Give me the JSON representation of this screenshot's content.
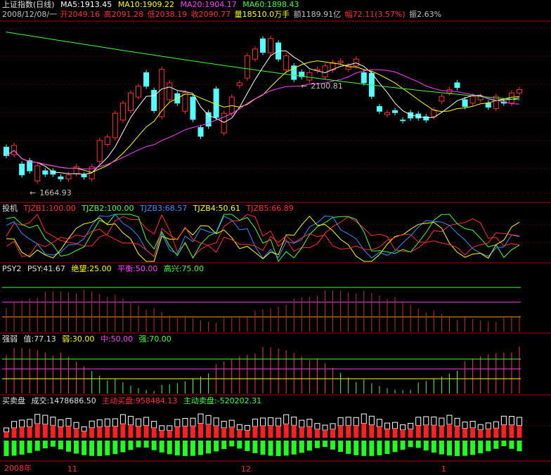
{
  "main": {
    "title": "上证指数(日线)",
    "ma": [
      {
        "label": "MA5:1913.45",
        "color": "#ffffff"
      },
      {
        "label": "MA10:1909.22",
        "color": "#ffff00"
      },
      {
        "label": "MA20:1904.17",
        "color": "#ff40ff"
      },
      {
        "label": "MA60:1898.43",
        "color": "#40ff40"
      }
    ],
    "info": [
      {
        "text": "2008/12/08/一",
        "color": "#c0c0c0"
      },
      {
        "text": "开2049.16",
        "color": "#ff3030"
      },
      {
        "text": "高2091.28",
        "color": "#ff3030"
      },
      {
        "text": "低2038.19",
        "color": "#ff3030"
      },
      {
        "text": "收2090.77",
        "color": "#ff3030"
      },
      {
        "text": "量18510.0万手",
        "color": "#ffff00"
      },
      {
        "text": "额1189.91亿",
        "color": "#c0c0c0"
      },
      {
        "text": "幅72.11(3.57%)",
        "color": "#ff3030"
      },
      {
        "text": "振2.63%",
        "color": "#c0c0c0"
      }
    ],
    "high_label": "2100.81",
    "low_label": "1664.93"
  },
  "panel_tj": {
    "title": "投机",
    "items": [
      {
        "label": "TJZB1:100.00",
        "color": "#ff3030"
      },
      {
        "label": "TJZB2:100.00",
        "color": "#40ff40"
      },
      {
        "label": "TJZB3:68.57",
        "color": "#3090ff"
      },
      {
        "label": "TJZB4:50.61",
        "color": "#ffff00"
      },
      {
        "label": "TJZB5:66.89",
        "color": "#ff3030"
      }
    ]
  },
  "panel_psy": {
    "title": "PSY2",
    "items": [
      {
        "label": "PSY:41.67",
        "color": "#e0e0e0"
      },
      {
        "label": "绝望:25.00",
        "color": "#ffff00"
      },
      {
        "label": "平衡:50.00",
        "color": "#ff40ff"
      },
      {
        "label": "高兴:75.00",
        "color": "#40ff40"
      }
    ]
  },
  "panel_qr": {
    "title": "强弱",
    "items": [
      {
        "label": "值:77.13",
        "color": "#e0e0e0"
      },
      {
        "label": "弱:30.00",
        "color": "#ffff00"
      },
      {
        "label": "中:50.00",
        "color": "#ff40ff"
      },
      {
        "label": "强:70.00",
        "color": "#40ff40"
      }
    ]
  },
  "panel_mm": {
    "title": "买卖盘",
    "items": [
      {
        "label": "成交:1478686.50",
        "color": "#e0e0e0"
      },
      {
        "label": "主动买盘:958484.13",
        "color": "#ff3030"
      },
      {
        "label": "主动卖盘:-520202.31",
        "color": "#40ff40"
      }
    ]
  },
  "time_axis": {
    "year": "2008年",
    "m11": "11",
    "m12": "12",
    "m1": "1"
  },
  "chart_data": {
    "type": "candlestick",
    "candles": [
      {
        "o": 1770,
        "c": 1745
      },
      {
        "o": 1748,
        "c": 1775
      },
      {
        "o": 1720,
        "c": 1688
      },
      {
        "o": 1730,
        "c": 1700
      },
      {
        "o": 1670,
        "c": 1715
      },
      {
        "o": 1700,
        "c": 1690
      },
      {
        "o": 1700,
        "c": 1690
      },
      {
        "o": 1682,
        "c": 1676
      },
      {
        "o": 1676,
        "c": 1688
      },
      {
        "o": 1692,
        "c": 1712
      },
      {
        "o": 1688,
        "c": 1682
      },
      {
        "o": 1676,
        "c": 1712
      },
      {
        "o": 1728,
        "c": 1790
      },
      {
        "o": 1778,
        "c": 1800
      },
      {
        "o": 1798,
        "c": 1870
      },
      {
        "o": 1850,
        "c": 1900
      },
      {
        "o": 1878,
        "c": 1930
      },
      {
        "o": 1918,
        "c": 1950
      },
      {
        "o": 1990,
        "c": 1950
      },
      {
        "o": 1938,
        "c": 1878
      },
      {
        "o": 1860,
        "c": 2000
      },
      {
        "o": 1910,
        "c": 1960
      },
      {
        "o": 1928,
        "c": 1900
      },
      {
        "o": 1876,
        "c": 1932
      },
      {
        "o": 1918,
        "c": 1852
      },
      {
        "o": 1828,
        "c": 1802
      },
      {
        "o": 1872,
        "c": 1832
      },
      {
        "o": 1942,
        "c": 1858
      },
      {
        "o": 1812,
        "c": 1870
      },
      {
        "o": 1870,
        "c": 1918
      },
      {
        "o": 1952,
        "c": 1960
      },
      {
        "o": 1974,
        "c": 2040
      },
      {
        "o": 2030,
        "c": 2060
      },
      {
        "o": 2090,
        "c": 2050
      },
      {
        "o": 2049,
        "c": 2091
      },
      {
        "o": 2078,
        "c": 2030
      },
      {
        "o": 1998,
        "c": 2040
      },
      {
        "o": 2010,
        "c": 1970
      },
      {
        "o": 1992,
        "c": 1978
      },
      {
        "o": 1968,
        "c": 1990
      },
      {
        "o": 1996,
        "c": 2000
      },
      {
        "o": 1978,
        "c": 2010
      },
      {
        "o": 1998,
        "c": 2020
      },
      {
        "o": 2020,
        "c": 2024
      },
      {
        "o": 2000,
        "c": 2010
      },
      {
        "o": 2010,
        "c": 2030
      },
      {
        "o": 1990,
        "c": 1960
      },
      {
        "o": 1988,
        "c": 1920
      },
      {
        "o": 1890,
        "c": 1876
      },
      {
        "o": 1866,
        "c": 1872
      },
      {
        "o": 1878,
        "c": 1872
      },
      {
        "o": 1850,
        "c": 1848
      },
      {
        "o": 1872,
        "c": 1856
      },
      {
        "o": 1868,
        "c": 1856
      },
      {
        "o": 1860,
        "c": 1850
      },
      {
        "o": 1860,
        "c": 1880
      },
      {
        "o": 1906,
        "c": 1920
      },
      {
        "o": 1930,
        "c": 1940
      },
      {
        "o": 1960,
        "c": 1946
      },
      {
        "o": 1910,
        "c": 1890
      },
      {
        "o": 1900,
        "c": 1920
      },
      {
        "o": 1910,
        "c": 1920
      },
      {
        "o": 1900,
        "c": 1888
      },
      {
        "o": 1884,
        "c": 1920
      },
      {
        "o": 1904,
        "c": 1900
      },
      {
        "o": 1900,
        "c": 1930
      },
      {
        "o": 1930,
        "c": 1940
      }
    ]
  }
}
